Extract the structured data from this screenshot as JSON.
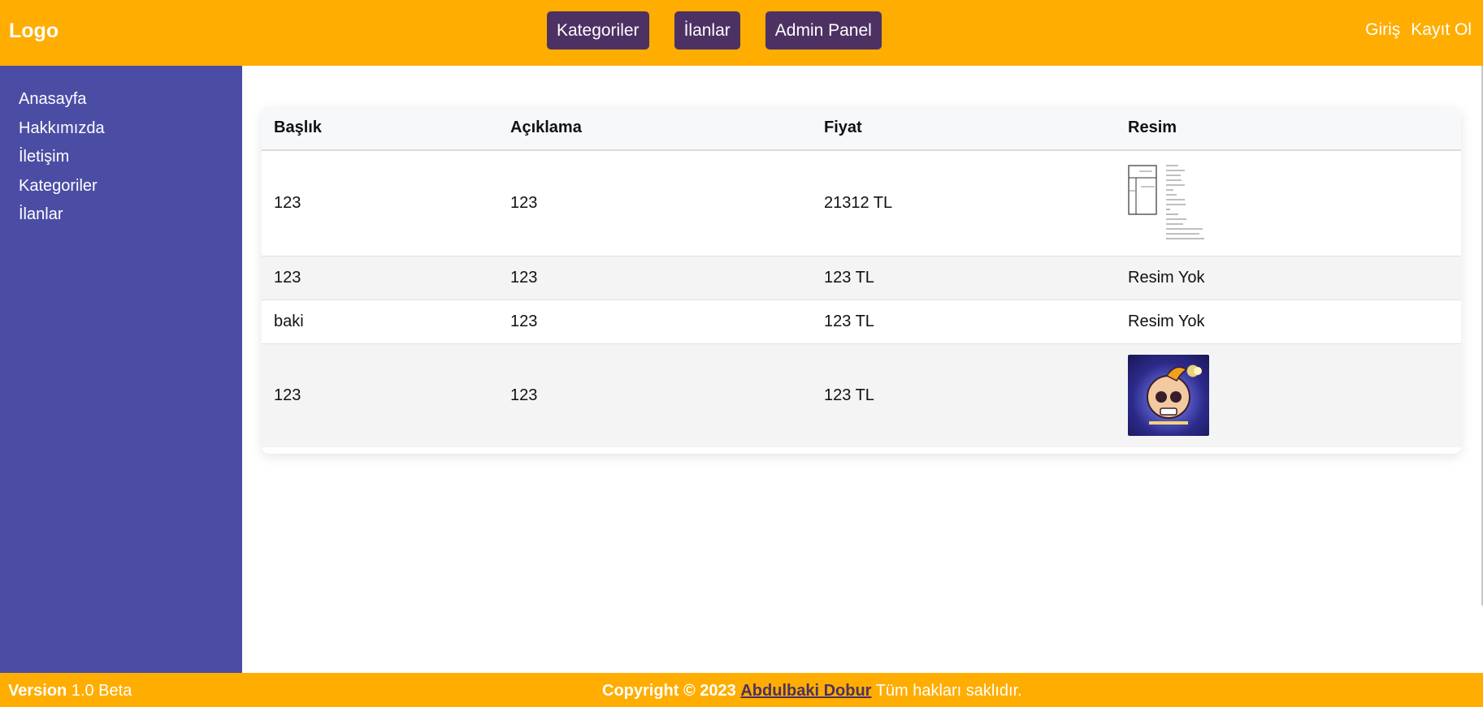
{
  "header": {
    "logo": "Logo",
    "nav": [
      "Kategoriler",
      "İlanlar",
      "Admin Panel"
    ],
    "auth": {
      "login": "Giriş",
      "register": "Kayıt Ol"
    }
  },
  "sidebar": {
    "items": [
      "Anasayfa",
      "Hakkımızda",
      "İletişim",
      "Kategoriler",
      "İlanlar"
    ]
  },
  "table": {
    "headers": [
      "Başlık",
      "Açıklama",
      "Fiyat",
      "Resim"
    ],
    "rows": [
      {
        "title": "123",
        "description": "123",
        "price": "21312 TL",
        "image": "document-thumbnail"
      },
      {
        "title": "123",
        "description": "123",
        "price": "123 TL",
        "image_text": "Resim Yok"
      },
      {
        "title": "baki",
        "description": "123",
        "price": "123 TL",
        "image_text": "Resim Yok"
      },
      {
        "title": "123",
        "description": "123",
        "price": "123 TL",
        "image": "skull-logo-thumbnail"
      }
    ]
  },
  "footer": {
    "version_label": "Version",
    "version_value": " 1.0 Beta",
    "copyright_prefix": "Copyright © 2023",
    "author": "Abdulbaki Dobur",
    "copyright_suffix": " Tüm hakları saklıdır."
  },
  "colors": {
    "topbar": "#ffad00",
    "sidebar": "#4b4da4",
    "nav_button": "#4d3163"
  }
}
